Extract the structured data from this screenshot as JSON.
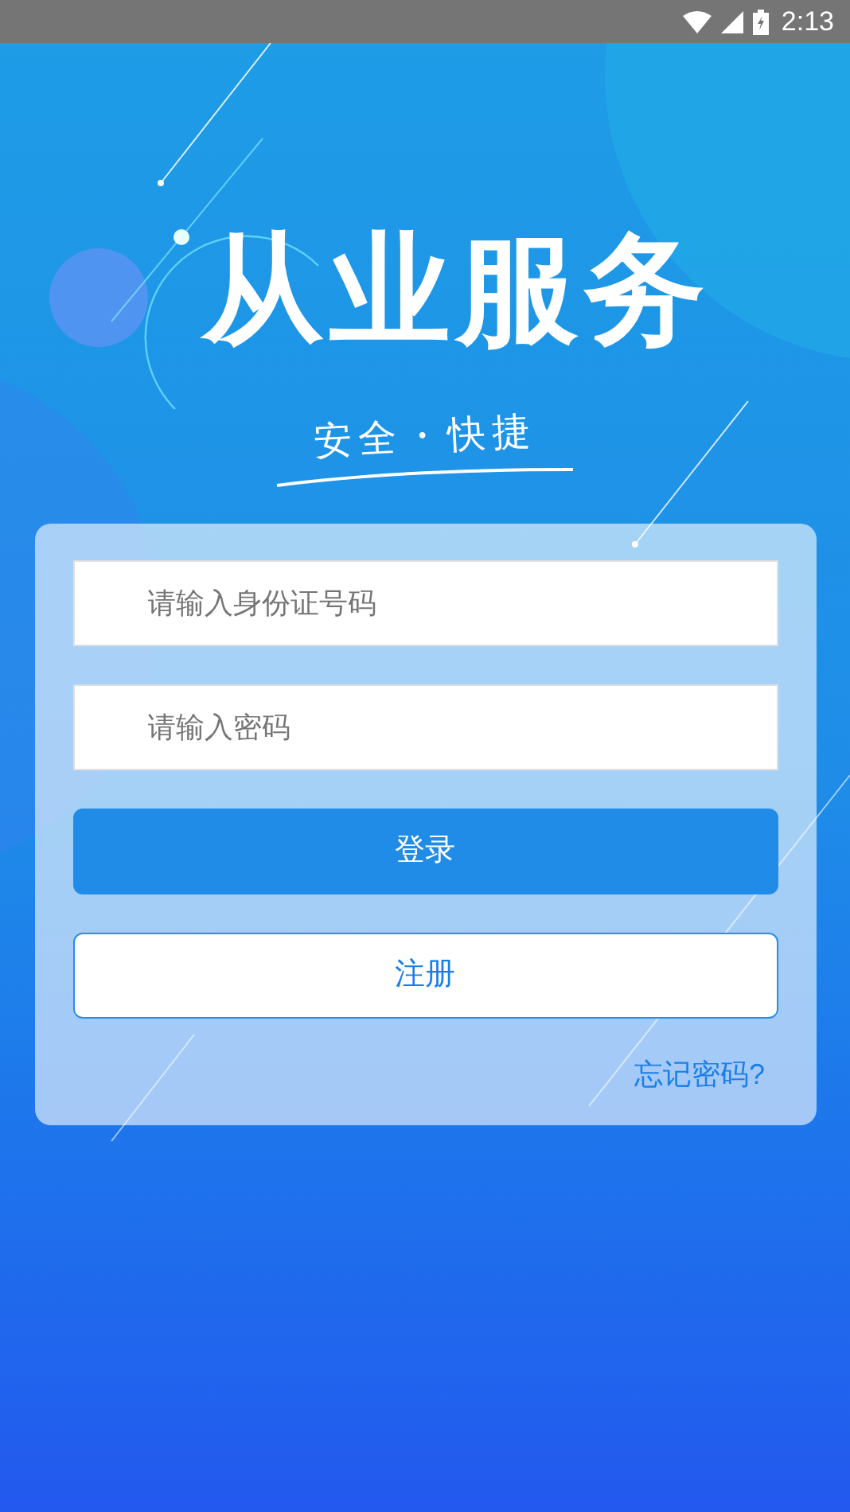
{
  "status_bar": {
    "time": "2:13"
  },
  "header": {
    "title": "从业服务",
    "tagline": "安全・快捷"
  },
  "form": {
    "fields": [
      {
        "placeholder": "请输入身份证号码"
      },
      {
        "placeholder": "请输入密码"
      }
    ],
    "buttons": [
      {
        "kind": "primary",
        "label": "登录"
      },
      {
        "kind": "secondary",
        "label": "注册"
      }
    ],
    "forgot_link": "忘记密码?"
  }
}
